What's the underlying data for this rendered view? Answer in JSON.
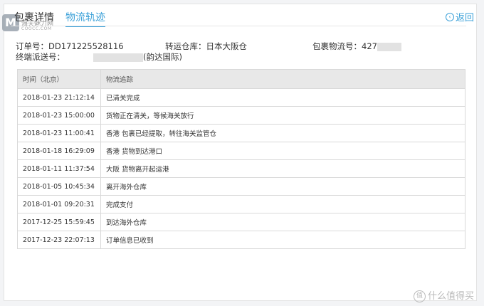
{
  "header": {
    "tabs": [
      {
        "label": "包裹详情"
      },
      {
        "label": "物流轨迹"
      }
    ],
    "back_label": "返回"
  },
  "logo": {
    "letter": "M",
    "subtitle": "海天魅力网",
    "site": "COOCC.COM"
  },
  "info": {
    "order_label": "订单号：",
    "order_value": "DD171225528116",
    "warehouse_label": "转运仓库：",
    "warehouse_value": "日本大阪仓",
    "tracking_label": "包裹物流号：",
    "tracking_value": "427",
    "delivery_label": "终端派送号：",
    "delivery_carrier": "(韵达国际)"
  },
  "table": {
    "headers": [
      "时间（北京）",
      "物流追踪"
    ],
    "rows": [
      {
        "time": "2018-01-23 21:12:14",
        "event": "已清关完成"
      },
      {
        "time": "2018-01-23 15:00:00",
        "event": "货物正在清关，等候海关放行"
      },
      {
        "time": "2018-01-23 11:00:41",
        "event": "香港 包裹已经提取，转往海关监管仓"
      },
      {
        "time": "2018-01-18 16:29:09",
        "event": "香港 货物到达港口"
      },
      {
        "time": "2018-01-11 11:37:54",
        "event": "大阪 货物离开起运港"
      },
      {
        "time": "2018-01-05 10:45:34",
        "event": "离开海外仓库"
      },
      {
        "time": "2018-01-01 09:20:31",
        "event": "完成支付"
      },
      {
        "time": "2017-12-25 15:59:45",
        "event": "到达海外仓库"
      },
      {
        "time": "2017-12-23 22:07:13",
        "event": "订单信息已收到"
      }
    ]
  },
  "watermark": {
    "badge": "值",
    "text": "什么值得买"
  }
}
